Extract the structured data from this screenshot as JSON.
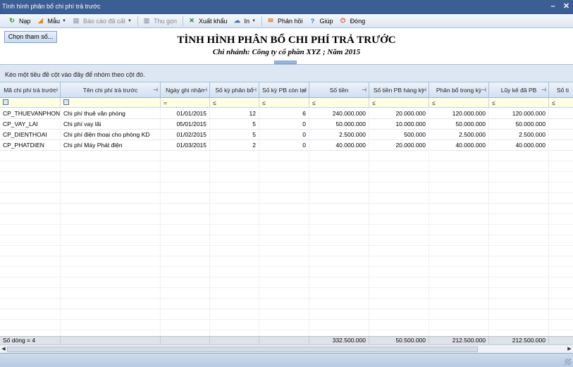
{
  "window": {
    "title": "Tình hình phân bổ chi phí trả trước",
    "min": "–",
    "close": "✕"
  },
  "toolbar": [
    {
      "label": "Nạp",
      "icon": "refresh-icon",
      "glyph": "↻",
      "color": "#2e8b2e",
      "disabled": false,
      "dropdown": false
    },
    {
      "label": "Mẫu",
      "icon": "template-icon",
      "glyph": "◢",
      "color": "#e08a1e",
      "disabled": false,
      "dropdown": true
    },
    {
      "label": "Báo cáo đã cất",
      "icon": "saved-report-icon",
      "glyph": "▤",
      "color": "#9aa5b4",
      "disabled": true,
      "dropdown": true
    },
    {
      "label": "Thu gọn",
      "icon": "collapse-icon",
      "glyph": "▥",
      "color": "#9aa5b4",
      "disabled": true,
      "dropdown": false
    },
    {
      "label": "Xuất khẩu",
      "icon": "excel-export-icon",
      "glyph": "✕",
      "color": "#1f7a3a",
      "disabled": false,
      "dropdown": false
    },
    {
      "label": "In",
      "icon": "printer-icon",
      "glyph": "☁",
      "color": "#4a6fa5",
      "disabled": false,
      "dropdown": true
    },
    {
      "label": "Phản hồi",
      "icon": "feedback-mail-icon",
      "glyph": "✉",
      "color": "#e07a1e",
      "disabled": false,
      "dropdown": false
    },
    {
      "label": "Giúp",
      "icon": "help-icon",
      "glyph": "?",
      "color": "#2f6fc8",
      "disabled": false,
      "dropdown": false
    },
    {
      "label": "Đóng",
      "icon": "close-report-icon",
      "glyph": "⏻",
      "color": "#d9462a",
      "disabled": false,
      "dropdown": false
    }
  ],
  "header": {
    "params_button": "Chọn tham số...",
    "title": "TÌNH HÌNH PHÂN BỔ CHI PHÍ TRẢ TRƯỚC",
    "subtitle": "Chi nhánh: Công ty cổ phần XYZ ; Năm 2015"
  },
  "group_hint": "Kéo một tiêu đề cột vào đây để nhóm theo cột đó.",
  "columns": [
    {
      "label": "Mã chi phí trả trước",
      "filter": "box"
    },
    {
      "label": "Tên chi phí trả trước",
      "filter": "box"
    },
    {
      "label": "Ngày ghi nhận",
      "filter": "="
    },
    {
      "label": "Số kỳ phân bổ",
      "filter": "≤"
    },
    {
      "label": "Số kỳ PB còn lại",
      "filter": "≤"
    },
    {
      "label": "Số tiền",
      "filter": "≤"
    },
    {
      "label": "Số tiền PB hàng kỳ",
      "filter": "≤"
    },
    {
      "label": "Phân bổ trong kỳ",
      "filter": "≤"
    },
    {
      "label": "Lũy kế đã PB",
      "filter": "≤"
    },
    {
      "label": "Số ti",
      "filter": "≤"
    }
  ],
  "rows": [
    [
      "CP_THUEVANPHON",
      "Chi phí thuê văn phòng",
      "01/01/2015",
      "12",
      "6",
      "240.000.000",
      "20.000.000",
      "120.000.000",
      "120.000.000",
      ""
    ],
    [
      "CP_VAY_LAI",
      "Chi phí vay lãi",
      "05/01/2015",
      "5",
      "0",
      "50.000.000",
      "10.000.000",
      "50.000.000",
      "50.000.000",
      ""
    ],
    [
      "CP_DIENTHOAI",
      "Chi phí điện thoại cho phòng KD",
      "01/02/2015",
      "5",
      "0",
      "2.500.000",
      "500.000",
      "2.500.000",
      "2.500.000",
      ""
    ],
    [
      "CP_PHATDIEN",
      "Chi phí Máy Phát điện",
      "01/03/2015",
      "2",
      "0",
      "40.000.000",
      "20.000.000",
      "40.000.000",
      "40.000.000",
      ""
    ]
  ],
  "footer": [
    "Số dòng = 4",
    "",
    "",
    "",
    "",
    "332.500.000",
    "50.500.000",
    "212.500.000",
    "212.500.000",
    ""
  ]
}
